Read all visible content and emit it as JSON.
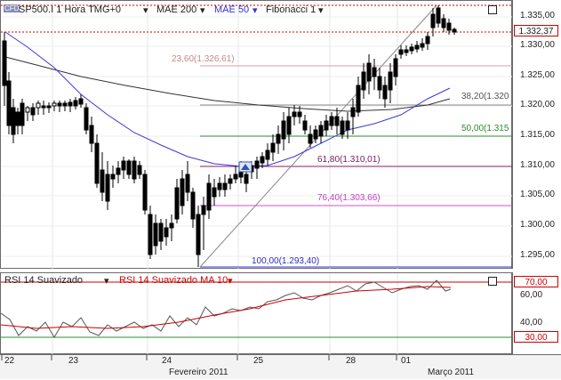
{
  "header": {
    "symbol": "SP500.I 1 Hora TMG+0",
    "ma200": "MAE 200",
    "ma50": "MAE 50",
    "fibonacci": "Fibonacci 1",
    "cfd_badge": "CFD"
  },
  "rsi_header": {
    "rsi": "RSI 14 Suavizado",
    "rsi_ma": "RSI 14 Suavizado MA 10"
  },
  "price_axis": {
    "ticks": [
      "1.335,00",
      "1.330,00",
      "1.325,00",
      "1.320,00",
      "1.315,00",
      "1.310,00",
      "1.305,00",
      "1.300,00",
      "1.295,00"
    ],
    "current_price": "1.332,37"
  },
  "rsi_axis": {
    "ticks": [
      "70,00",
      "60,00",
      "40,00",
      "30,00"
    ]
  },
  "time_axis": {
    "days": [
      "22",
      "23",
      "24",
      "25",
      "28",
      "01"
    ],
    "months": [
      "Fevereiro 2011",
      "Março 2011"
    ]
  },
  "fib_levels": [
    {
      "label": "23,60(1.326,61)",
      "color": "#c08b8b"
    },
    {
      "label": "38,20(1.320",
      "color": "#555555"
    },
    {
      "label": "50,00(1.315",
      "color": "#2e8b2e"
    },
    {
      "label": "61,80(1.310,01)",
      "color": "#7a1a5a"
    },
    {
      "label": "76,40(1.303,66)",
      "color": "#c040c0"
    },
    {
      "label": "100,00(1.293,40)",
      "color": "#2c2cc0"
    }
  ],
  "chart_data": {
    "type": "candlestick",
    "y_range": [
      1292.2,
      1337.6
    ],
    "rsi_range": [
      20,
      76
    ]
  }
}
